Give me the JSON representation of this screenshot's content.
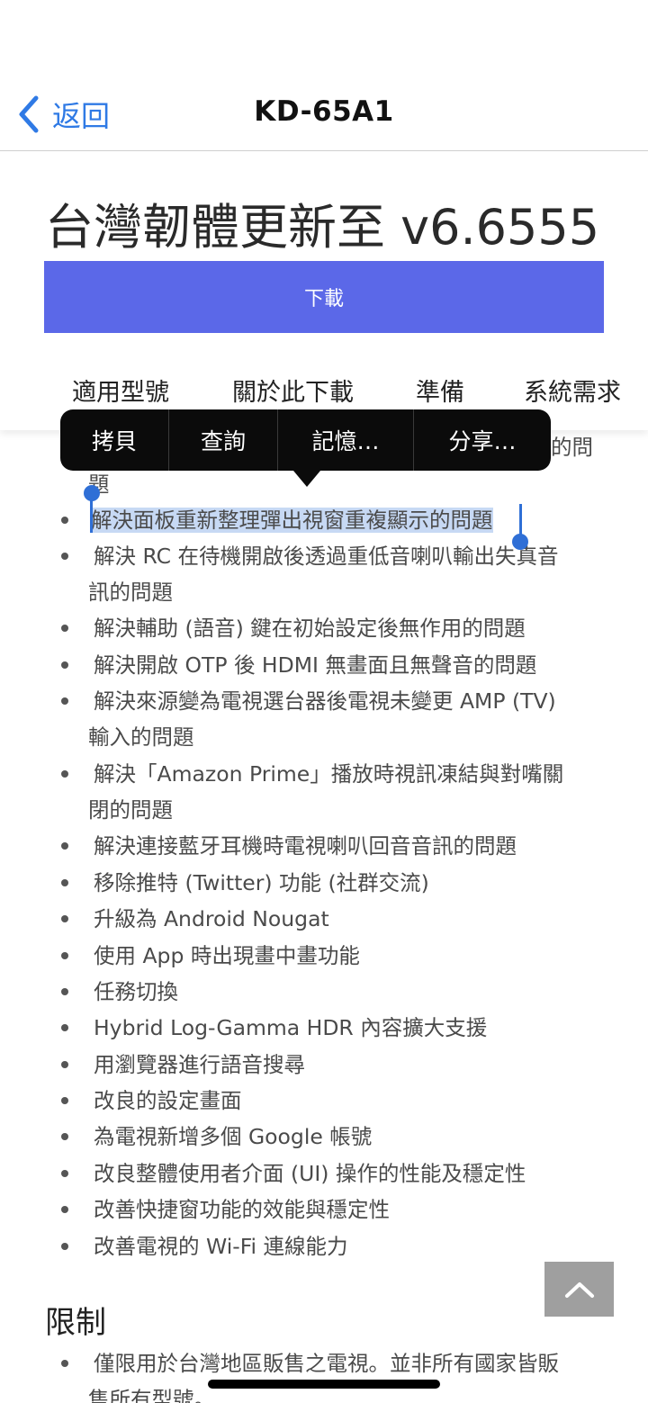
{
  "nav": {
    "back_label": "返回",
    "title": "KD-65A1"
  },
  "header": {
    "title": "台灣韌體更新至 v6.6555",
    "download_label": "下載",
    "tabs": [
      "適用型號",
      "關於此下載",
      "準備",
      "系統需求"
    ]
  },
  "context_menu": {
    "items": [
      "拷貝",
      "查詢",
      "記憶…",
      "分享…"
    ]
  },
  "content": {
    "partial_line_top": "的問",
    "partial_line_2": "題",
    "items": [
      "解決面板重新整理彈出視窗重複顯示的問題",
      "解決 RC 在待機開啟後透過重低音喇叭輸出失真音",
      "訊的問題",
      "解決輔助 (語音) 鍵在初始設定後無作用的問題",
      "解決開啟 OTP 後 HDMI 無畫面且無聲音的問題",
      "解決來源變為電視選台器後電視未變更 AMP (TV)",
      "輸入的問題",
      "解決「Amazon Prime」播放時視訊凍結與對嘴關",
      "閉的問題",
      "解決連接藍牙耳機時電視喇叭回音音訊的問題",
      "移除推特 (Twitter) 功能 (社群交流)",
      "升級為 Android Nougat",
      "使用 App 時出現畫中畫功能",
      "任務切換",
      "Hybrid Log-Gamma HDR 內容擴大支援",
      "用瀏覽器進行語音搜尋",
      "改良的設定畫面",
      "為電視新增多個 Google 帳號",
      "改良整體使用者介面 (UI) 操作的性能及穩定性",
      "改善快捷窗功能的效能與穩定性",
      "改善電視的 Wi-Fi 連線能力"
    ]
  },
  "limits": {
    "title": "限制",
    "line1": "僅限用於台灣地區販售之電視。並非所有國家皆販",
    "line2": "售所有型號。"
  },
  "colors": {
    "accent_blue": "#2f7ae5",
    "download_button": "#5b68e8",
    "selection": "#c7d9f4"
  }
}
